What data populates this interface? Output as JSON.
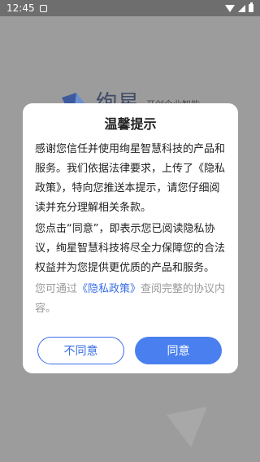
{
  "status_bar": {
    "time": "12:45",
    "icons": [
      "notification-icon",
      "wifi-icon",
      "signal-icon",
      "battery-icon"
    ]
  },
  "splash": {
    "title": "绚星",
    "subtitle": "开创企业智能"
  },
  "dialog": {
    "title": "温馨提示",
    "para1": "感谢您信任并使用绚星智慧科技的产品和服务。我们依据法律要求，上传了《隐私政策》，特向您推送本提示，请您仔细阅读并充分理解相关条款。",
    "para2": "您点击“同意”，即表示您已阅读隐私协议，绚星智慧科技将尽全力保障您的合法权益并为您提供更优质的产品和服务。",
    "para3_prefix": "您可通过",
    "policy_link": "《隐私政策》",
    "para3_suffix": "查阅完整的协议内容。",
    "decline_label": "不同意",
    "agree_label": "同意"
  },
  "colors": {
    "accent": "#4a7ff0",
    "link": "#3a6fe6",
    "overlay": "#8a8a8a"
  }
}
